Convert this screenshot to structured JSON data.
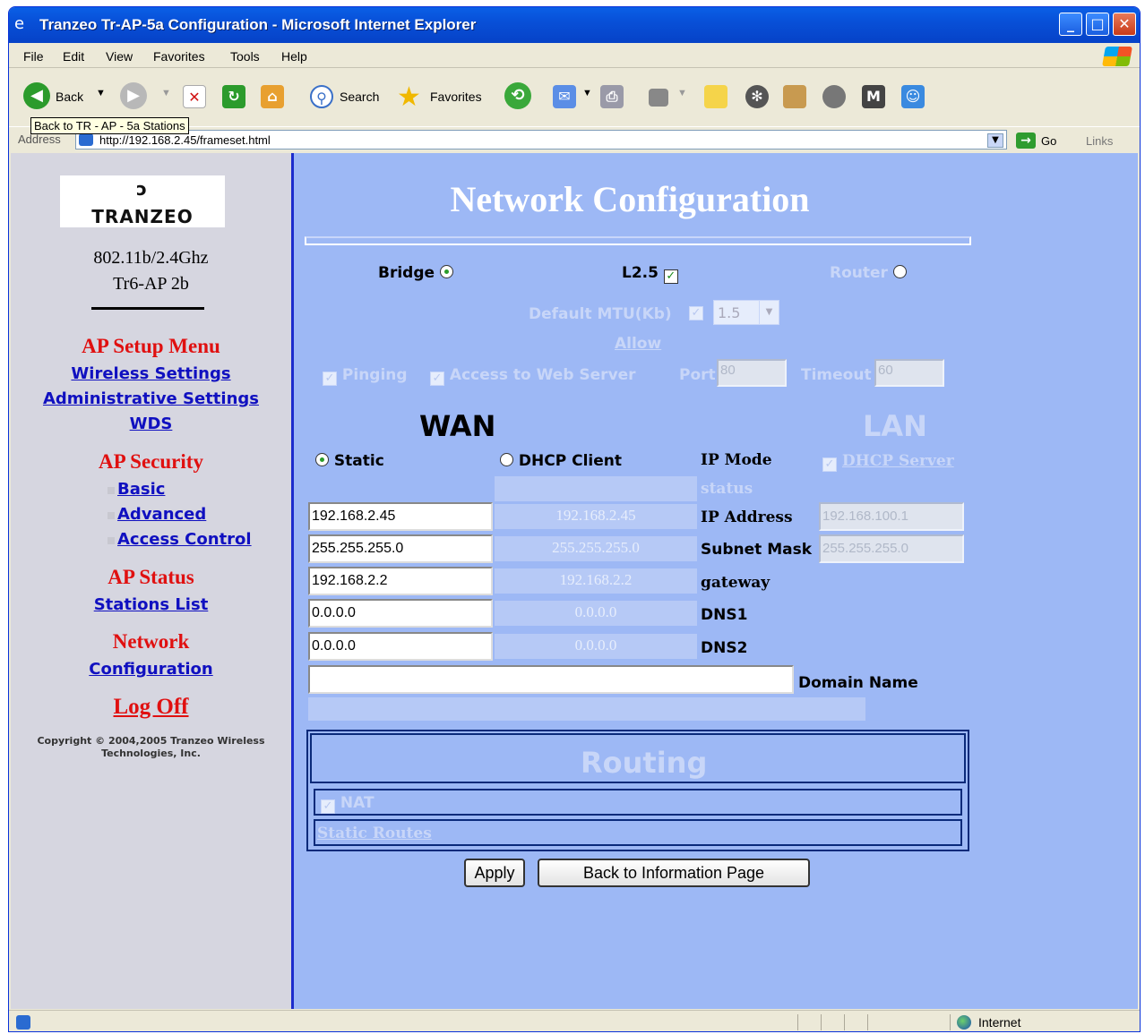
{
  "window": {
    "title": "Tranzeo Tr-AP-5a Configuration - Microsoft Internet Explorer"
  },
  "menubar": [
    "File",
    "Edit",
    "View",
    "Favorites",
    "Tools",
    "Help"
  ],
  "toolbar": {
    "back": "Back",
    "search": "Search",
    "favorites": "Favorites",
    "tooltip": "Back to TR - AP - 5a Stations"
  },
  "address": {
    "label": "Address",
    "url": "http://192.168.2.45/frameset.html",
    "go": "Go",
    "links": "Links"
  },
  "sidebar": {
    "logo_text": "TRANZEO",
    "model_line1": "802.11b/2.4Ghz",
    "model_line2": "Tr6-AP 2b",
    "setup_head": "AP Setup Menu",
    "wireless": "Wireless Settings",
    "admin": "Administrative Settings",
    "wds": "WDS",
    "security_head": "AP Security",
    "basic": "Basic",
    "advanced": "Advanced",
    "access_control": "Access Control",
    "status_head": "AP Status",
    "stations": "Stations List",
    "network_head": "Network",
    "configuration": "Configuration",
    "logoff": "Log Off",
    "copyright_1": "Copyright © 2004,2005 Tranzeo Wireless",
    "copyright_2": "Technologies, Inc."
  },
  "main": {
    "title": "Network Configuration",
    "mode": {
      "bridge": "Bridge",
      "l25": "L2.5",
      "router": "Router",
      "selected": "Bridge"
    },
    "mtu": {
      "label": "Default MTU(Kb)",
      "value": "1.5"
    },
    "allow": {
      "label": "Allow",
      "pinging": "Pinging",
      "web": "Access to Web Server",
      "port_label": "Port",
      "port": "80",
      "timeout_label": "Timeout",
      "timeout": "60"
    },
    "wan": {
      "heading": "WAN",
      "static": "Static",
      "dhcp": "DHCP Client",
      "ip": "192.168.2.45",
      "subnet": "255.255.255.0",
      "gateway": "192.168.2.2",
      "dns1": "0.0.0.0",
      "dns2": "0.0.0.0",
      "domain": ""
    },
    "status_col": {
      "header": "status",
      "ip": "192.168.2.45",
      "subnet": "255.255.255.0",
      "gateway": "192.168.2.2",
      "dns1": "0.0.0.0",
      "dns2": "0.0.0.0"
    },
    "labels": {
      "ip_mode": "IP Mode",
      "ip": "IP Address",
      "subnet": "Subnet Mask",
      "gateway": "gateway",
      "dns1": "DNS1",
      "dns2": "DNS2",
      "domain": "Domain Name"
    },
    "lan": {
      "heading": "LAN",
      "dhcp_server": "DHCP Server",
      "ip": "192.168.100.1",
      "subnet": "255.255.255.0"
    },
    "routing": {
      "heading": "Routing",
      "nat": "NAT",
      "static_routes": "Static Routes"
    },
    "buttons": {
      "apply": "Apply",
      "back": "Back to Information Page"
    }
  },
  "statusbar": {
    "zone": "Internet"
  }
}
